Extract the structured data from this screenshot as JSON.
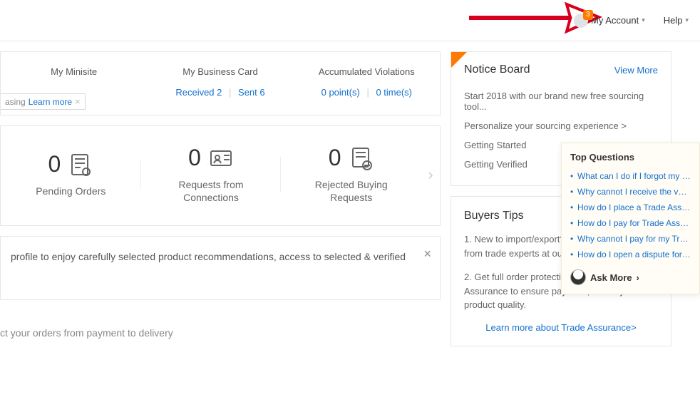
{
  "header": {
    "badge": "3",
    "my_account": "My Account",
    "help": "Help"
  },
  "links": {
    "minisite": {
      "title": "My Minisite"
    },
    "bizcard": {
      "title": "My Business Card",
      "received": "Received 2",
      "sent": "Sent 6"
    },
    "violations": {
      "title": "Accumulated Violations",
      "points": "0 point(s)",
      "times": "0 time(s)"
    }
  },
  "pill": {
    "text": "asing",
    "link": "Learn more"
  },
  "stats": [
    {
      "num": "0",
      "label": "Pending Orders"
    },
    {
      "num": "0",
      "label": "Requests from\nConnections"
    },
    {
      "num": "0",
      "label": "Rejected Buying\nRequests"
    }
  ],
  "recs": {
    "text": "profile to enjoy carefully selected product recommendations, access to selected & verified"
  },
  "protect": {
    "text": "ct your orders from payment to delivery"
  },
  "notice": {
    "title": "Notice Board",
    "view_more": "View More",
    "items": [
      "Start 2018 with our brand new free sourcing tool...",
      "Personalize your sourcing experience >",
      "Getting Started",
      "Getting Verified"
    ]
  },
  "tips": {
    "title": "Buyers Tips",
    "p1": "1. New to import/export? Get expert advice from trade experts at our free weekly webinar!",
    "p2": "2. Get full order protection with Trade Assurance to ensure payment, delivery and product quality.",
    "link": "Learn more about Trade Assurance>"
  },
  "popover": {
    "title": "Top Questions",
    "items": [
      "What can I do if I forgot my p...",
      "Why cannot I receive the verif...",
      "How do I place a Trade Assur...",
      "How do I pay for Trade Assur...",
      "Why cannot I pay for my Trad...",
      "How do I open a dispute for ..."
    ],
    "ask": "Ask More"
  }
}
